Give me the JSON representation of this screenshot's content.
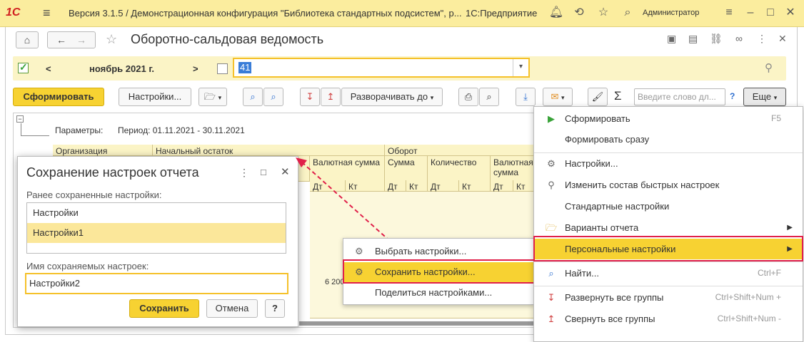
{
  "titlebar": {
    "logo": "1С",
    "title": "Версия 3.1.5 / Демонстрационная конфигурация \"Библиотека стандартных подсистем\", р...",
    "product": "1С:Предприятие",
    "user": "Администратор"
  },
  "header": {
    "page_title": "Оборотно-сальдовая ведомость",
    "home_icon": "home-icon",
    "back_icon": "arrow-left-icon",
    "forward_icon": "arrow-right-icon"
  },
  "period": {
    "prev": "<",
    "label": "ноябрь 2021 г.",
    "next": ">",
    "account_value": "41"
  },
  "toolbar": {
    "generate": "Сформировать",
    "settings": "Настройки...",
    "expand_to": "Разворачивать до",
    "search_placeholder": "Введите слово дл...",
    "help": "?",
    "more": "Еще"
  },
  "report": {
    "params_label": "Параметры:",
    "params_value": "Период: 01.11.2021 - 30.11.2021",
    "col_org": "Организация",
    "col_opening": "Начальный остаток",
    "col_turnover": "Оборот",
    "col_currency_sum": "Валютная сумма",
    "col_sum": "Сумма",
    "col_qty": "Количество",
    "dt": "Дт",
    "kt": "Кт",
    "value_fragment": "6 200"
  },
  "dialog": {
    "title": "Сохранение настроек отчета",
    "saved_label": "Ранее сохраненные настройки:",
    "saved_items": [
      "Настройки",
      "Настройки1"
    ],
    "name_label": "Имя сохраняемых настроек:",
    "name_value": "Настройки2",
    "save_button": "Сохранить",
    "cancel_button": "Отмена",
    "help_button": "?"
  },
  "submenu": {
    "items": [
      "Выбрать настройки...",
      "Сохранить настройки...",
      "Поделиться настройками..."
    ]
  },
  "menu": {
    "items": [
      {
        "label": "Сформировать",
        "shortcut": "F5"
      },
      {
        "label": "Формировать сразу",
        "shortcut": ""
      },
      {
        "label": "Настройки...",
        "shortcut": ""
      },
      {
        "label": "Изменить состав быстрых настроек",
        "shortcut": ""
      },
      {
        "label": "Стандартные настройки",
        "shortcut": ""
      },
      {
        "label": "Варианты отчета",
        "shortcut": ""
      },
      {
        "label": "Персональные настройки",
        "shortcut": ""
      },
      {
        "label": "Найти...",
        "shortcut": "Ctrl+F"
      },
      {
        "label": "Развернуть все группы",
        "shortcut": "Ctrl+Shift+Num +"
      },
      {
        "label": "Свернуть все группы",
        "shortcut": "Ctrl+Shift+Num -"
      }
    ]
  },
  "colors": {
    "accent_yellow": "#f7d232",
    "highlight_red": "#e0204a",
    "panel_yellow": "#fbf4c6"
  }
}
